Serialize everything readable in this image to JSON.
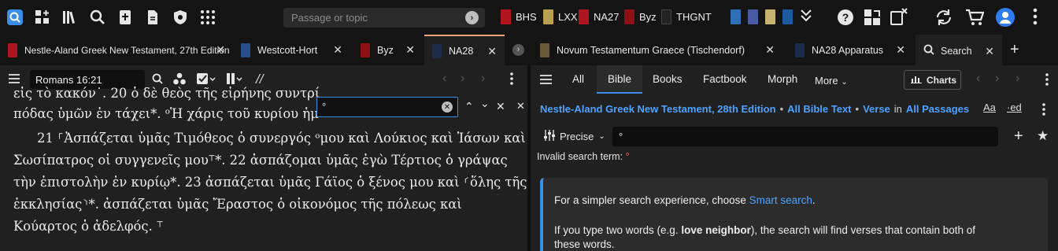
{
  "toolbar": {
    "passage_placeholder": "Passage or topic",
    "shortcuts": [
      {
        "label": "BHS",
        "color": "#b0141e"
      },
      {
        "label": "LXX",
        "color": "#b8a050"
      },
      {
        "label": "NA27",
        "color": "#b0141e"
      },
      {
        "label": "Byz",
        "color": "#8e1016"
      },
      {
        "label": "THGNT",
        "color": "#222222"
      }
    ]
  },
  "tabs": [
    {
      "label": "Nestle-Aland Greek New Testament, 27th Edition",
      "color": "#b0141e"
    },
    {
      "label": "Westcott-Hort",
      "color": "#2a4d8c"
    },
    {
      "label": "Byz",
      "color": "#8e1016"
    },
    {
      "label": "NA28",
      "color": "#1c2c4a"
    },
    {
      "label": "Novum Testamentum Graece (Tischendorf)",
      "color": "#6b5a3a"
    },
    {
      "label": "NA28 Apparatus",
      "color": "#1c2c4a"
    },
    {
      "label": "Search",
      "color": ""
    }
  ],
  "reader": {
    "reference": "Romans 16:21",
    "find_value": "°",
    "lines": [
      "εἰς τὸ κακόν˙. 20 ὁ δὲ θεὸς τῆς εἰρήνης συντρί",
      "πόδας ὑμῶν ἐν τάχει*. ᵒἩ χάρις τοῦ κυρίου ἡμ",
      "21 ⸀Ἀσπάζεται ὑμᾶς Τιμόθεος ὁ συνεργός ᵒμου καὶ Λούκιος καὶ Ἰάσων καὶ",
      "Σωσίπατρος οἱ συγγενεῖς μου⸆*. 22 ἀσπάζομαι ὑμᾶς ἐγὼ Τέρτιος ὁ γράψας",
      "τὴν ἐπιστολὴν ἐν κυρίῳ*. 23 ἀσπάζεται ὑμᾶς Γάϊος ὁ ξένος μου καὶ ⸂ὅλης τῆς",
      "ἐκκλησίας⸃*. ἀσπάζεται ὑμᾶς Ἔραστος ὁ οἰκονόμος τῆς πόλεως καὶ",
      "Κούαρτος ὁ ἀδελφός. ⸆"
    ]
  },
  "search": {
    "tabs": [
      "All",
      "Bible",
      "Books",
      "Factbook",
      "Morph",
      "More"
    ],
    "charts_label": "Charts",
    "scope": {
      "resource": "Nestle-Aland Greek New Testament, 28th Edition",
      "text": "All Bible Text",
      "unit": "Verse",
      "in_word": "in",
      "range": "All Passages"
    },
    "mode": "Precise",
    "query": "°",
    "error": "Invalid search term:",
    "error_mark": "°",
    "tip1_prefix": "For a simpler search experience, choose ",
    "tip1_link": "Smart search",
    "tip1_suffix": ".",
    "tip2_line1_prefix": "If you type two words (e.g. ",
    "tip2_bold": "love neighbor",
    "tip2_line1_suffix": "), the search will find verses that contain both of",
    "tip2_line2": "these words."
  }
}
